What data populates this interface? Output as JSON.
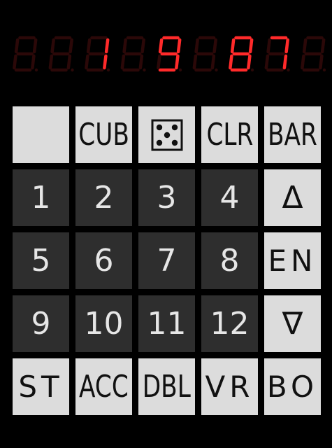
{
  "display": {
    "digits": [
      "",
      "",
      "1",
      "",
      "9",
      "",
      "8",
      "7",
      ""
    ]
  },
  "keys": [
    {
      "label": "",
      "style": "light",
      "name": "blank-key"
    },
    {
      "label": "CUB",
      "style": "light",
      "name": "cub-button"
    },
    {
      "label": "",
      "style": "light",
      "name": "dice-button",
      "icon": "dice-five-icon"
    },
    {
      "label": "CLR",
      "style": "light",
      "name": "clear-button"
    },
    {
      "label": "BAR",
      "style": "light",
      "name": "bar-button"
    },
    {
      "label": "1",
      "style": "dark",
      "name": "key-1"
    },
    {
      "label": "2",
      "style": "dark",
      "name": "key-2"
    },
    {
      "label": "3",
      "style": "dark",
      "name": "key-3"
    },
    {
      "label": "4",
      "style": "dark",
      "name": "key-4"
    },
    {
      "label": "Δ",
      "style": "light",
      "name": "up-button"
    },
    {
      "label": "5",
      "style": "dark",
      "name": "key-5"
    },
    {
      "label": "6",
      "style": "dark",
      "name": "key-6"
    },
    {
      "label": "7",
      "style": "dark",
      "name": "key-7"
    },
    {
      "label": "8",
      "style": "dark",
      "name": "key-8"
    },
    {
      "label": "EN",
      "style": "light",
      "name": "en-button"
    },
    {
      "label": "9",
      "style": "dark",
      "name": "key-9"
    },
    {
      "label": "10",
      "style": "dark",
      "name": "key-10"
    },
    {
      "label": "11",
      "style": "dark",
      "name": "key-11"
    },
    {
      "label": "12",
      "style": "dark",
      "name": "key-12"
    },
    {
      "label": "∇",
      "style": "light",
      "name": "down-button"
    },
    {
      "label": "ST",
      "style": "light",
      "name": "st-button"
    },
    {
      "label": "ACC",
      "style": "light",
      "name": "acc-button"
    },
    {
      "label": "DBL",
      "style": "light",
      "name": "dbl-button"
    },
    {
      "label": "VR",
      "style": "light",
      "name": "vr-button"
    },
    {
      "label": "BO",
      "style": "light",
      "name": "bo-button"
    }
  ]
}
